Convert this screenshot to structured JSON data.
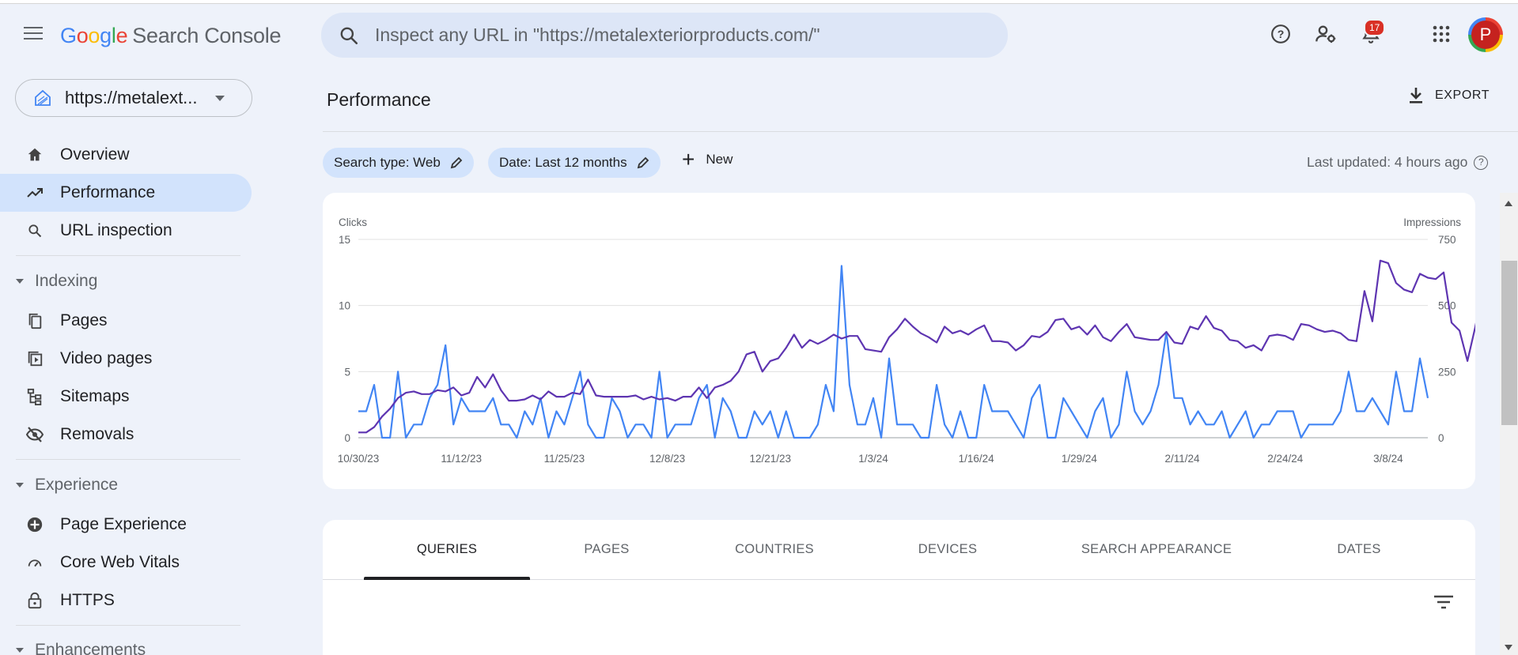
{
  "header": {
    "logo_letters": [
      "G",
      "o",
      "o",
      "g",
      "l",
      "e"
    ],
    "app_name": "Search Console",
    "search_placeholder": "Inspect any URL in \"https://metalexteriorproducts.com/\"",
    "notification_count": "17",
    "avatar_initial": "P",
    "icons": [
      "menu-icon",
      "search-icon",
      "help-icon",
      "user-settings-icon",
      "bell-icon",
      "apps-grid-icon"
    ]
  },
  "sidebar": {
    "property": "https://metalext...",
    "items": [
      {
        "label": "Overview",
        "icon": "home-icon"
      },
      {
        "label": "Performance",
        "icon": "trending-up-icon",
        "active": true
      },
      {
        "label": "URL inspection",
        "icon": "search-icon"
      }
    ],
    "sections": [
      {
        "title": "Indexing",
        "items": [
          {
            "label": "Pages",
            "icon": "pages-icon"
          },
          {
            "label": "Video pages",
            "icon": "video-pages-icon"
          },
          {
            "label": "Sitemaps",
            "icon": "sitemap-icon"
          },
          {
            "label": "Removals",
            "icon": "eye-off-icon"
          }
        ]
      },
      {
        "title": "Experience",
        "items": [
          {
            "label": "Page Experience",
            "icon": "page-experience-icon"
          },
          {
            "label": "Core Web Vitals",
            "icon": "gauge-icon"
          },
          {
            "label": "HTTPS",
            "icon": "lock-icon"
          }
        ]
      },
      {
        "title": "Enhancements",
        "items": []
      }
    ]
  },
  "main": {
    "title": "Performance",
    "export_label": "EXPORT",
    "filters": [
      "Search type: Web",
      "Date: Last 12 months"
    ],
    "new_label": "New",
    "last_updated": "Last updated: 4 hours ago",
    "tabs": [
      "QUERIES",
      "PAGES",
      "COUNTRIES",
      "DEVICES",
      "SEARCH APPEARANCE",
      "DATES"
    ],
    "active_tab": "QUERIES"
  },
  "colors": {
    "clicks": "#4285f4",
    "impressions": "#5e35b1",
    "accent": "#d2e3fc"
  },
  "chart_data": {
    "type": "line",
    "left_axis_label": "Clicks",
    "right_axis_label": "Impressions",
    "left_ticks": [
      "15",
      "10",
      "5",
      "0"
    ],
    "right_ticks": [
      "750",
      "500",
      "250",
      "0"
    ],
    "left_ylim": [
      0,
      15
    ],
    "right_ylim": [
      0,
      750
    ],
    "x_tick_labels": [
      "10/30/23",
      "11/12/23",
      "11/25/23",
      "12/8/23",
      "12/21/23",
      "1/3/24",
      "1/16/24",
      "1/29/24",
      "2/11/24",
      "2/24/24",
      "3/8/24"
    ],
    "x_range": [
      "10/30/23",
      "3/15/24"
    ],
    "series": [
      {
        "name": "Clicks",
        "axis": "left",
        "values": [
          2,
          2,
          4,
          0,
          0,
          5,
          0,
          1,
          1,
          3,
          4,
          7,
          1,
          3,
          2,
          2,
          2,
          3,
          1,
          1,
          0,
          2,
          1,
          3,
          0,
          2,
          1,
          3,
          5,
          1,
          0,
          0,
          3,
          2,
          0,
          1,
          1,
          0,
          5,
          0,
          1,
          1,
          1,
          3,
          4,
          0,
          3,
          2,
          0,
          0,
          2,
          1,
          2,
          0,
          2,
          0,
          0,
          0,
          1,
          4,
          2,
          13,
          4,
          1,
          1,
          3,
          0,
          6,
          1,
          1,
          1,
          0,
          0,
          4,
          1,
          0,
          2,
          0,
          0,
          4,
          2,
          2,
          2,
          1,
          0,
          3,
          4,
          0,
          0,
          3,
          2,
          1,
          0,
          2,
          3,
          0,
          1,
          5,
          2,
          1,
          2,
          4,
          8,
          3,
          3,
          1,
          2,
          1,
          1,
          2,
          0,
          1,
          2,
          0,
          1,
          1,
          2,
          2,
          2,
          0,
          1,
          1,
          1,
          1,
          2,
          5,
          2,
          2,
          3,
          2,
          1,
          5,
          2,
          2,
          6,
          3
        ]
      },
      {
        "name": "Impressions",
        "axis": "right",
        "values": [
          20,
          20,
          40,
          80,
          110,
          150,
          170,
          175,
          165,
          165,
          180,
          175,
          190,
          160,
          170,
          230,
          190,
          240,
          180,
          140,
          140,
          145,
          160,
          145,
          175,
          155,
          155,
          170,
          165,
          220,
          160,
          155,
          155,
          155,
          155,
          160,
          145,
          155,
          145,
          150,
          140,
          155,
          155,
          190,
          150,
          190,
          200,
          215,
          250,
          315,
          325,
          250,
          290,
          300,
          340,
          390,
          340,
          370,
          355,
          370,
          390,
          375,
          385,
          385,
          335,
          330,
          325,
          380,
          410,
          450,
          420,
          395,
          380,
          360,
          420,
          395,
          405,
          390,
          410,
          425,
          365,
          365,
          360,
          330,
          350,
          385,
          380,
          400,
          445,
          450,
          410,
          420,
          390,
          425,
          380,
          365,
          400,
          430,
          380,
          375,
          370,
          370,
          400,
          360,
          355,
          420,
          410,
          460,
          415,
          405,
          370,
          365,
          340,
          350,
          330,
          385,
          390,
          385,
          370,
          430,
          425,
          410,
          400,
          405,
          395,
          370,
          365,
          555,
          440,
          670,
          660,
          585,
          560,
          550,
          620,
          605,
          600,
          625,
          435,
          405,
          290,
          420,
          570
        ]
      }
    ]
  }
}
